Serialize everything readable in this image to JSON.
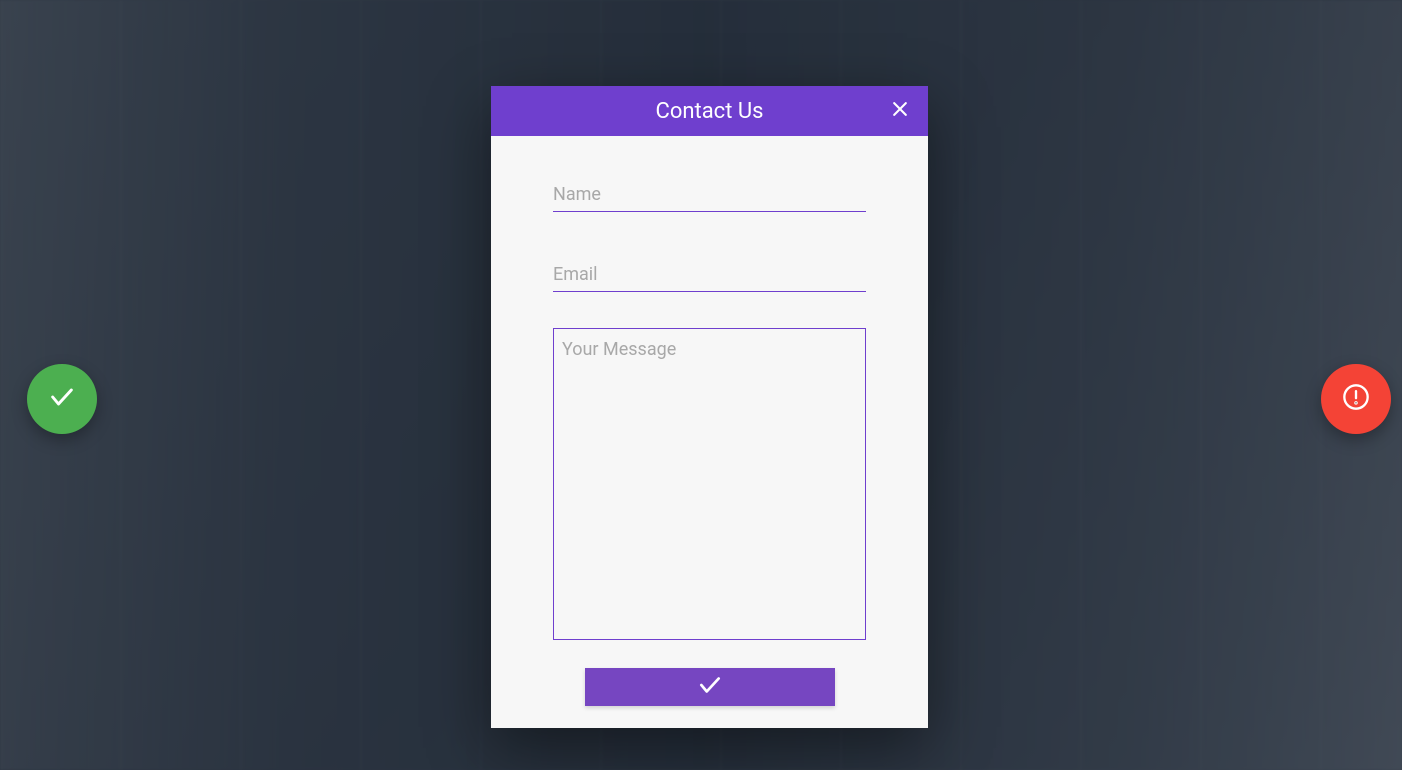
{
  "modal": {
    "title": "Contact Us",
    "fields": {
      "name_placeholder": "Name",
      "email_placeholder": "Email",
      "message_placeholder": "Your Message"
    }
  },
  "colors": {
    "accent": "#6f3fce",
    "success": "#4caf50",
    "error": "#f44336"
  }
}
